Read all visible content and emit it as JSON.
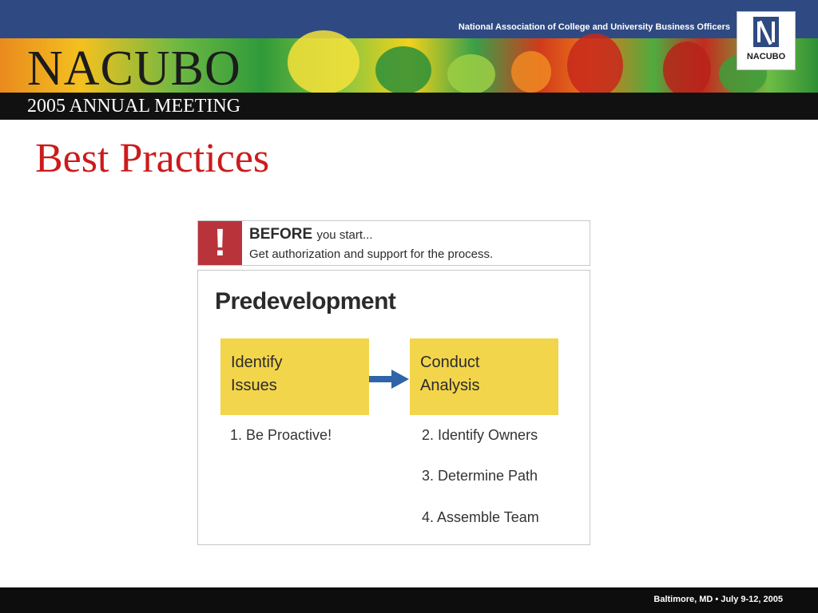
{
  "header": {
    "org_name": "National Association of College and University Business Officers",
    "wordmark": "NACUBO",
    "meeting": "2005 ANNUAL MEETING",
    "logo_text": "NACUBO"
  },
  "slide": {
    "title": "Best Practices"
  },
  "before": {
    "icon_glyph": "!",
    "heading_strong": "BEFORE",
    "heading_light": "you start...",
    "text": "Get authorization and support for the process."
  },
  "panel": {
    "title": "Predevelopment",
    "steps": [
      {
        "label_line1": "Identify",
        "label_line2": "Issues"
      },
      {
        "label_line1": "Conduct",
        "label_line2": "Analysis"
      }
    ],
    "items": [
      "1. Be Proactive!",
      "2. Identify Owners",
      "3. Determine Path",
      "4. Assemble Team"
    ]
  },
  "footer": {
    "text": "Baltimore, MD  •  July 9-12, 2005"
  },
  "colors": {
    "title_red": "#cc1b1b",
    "banner_blue": "#2f4a82",
    "step_yellow": "#f2d54b",
    "alert_red": "#b8343a",
    "arrow_blue": "#2f65a8"
  }
}
